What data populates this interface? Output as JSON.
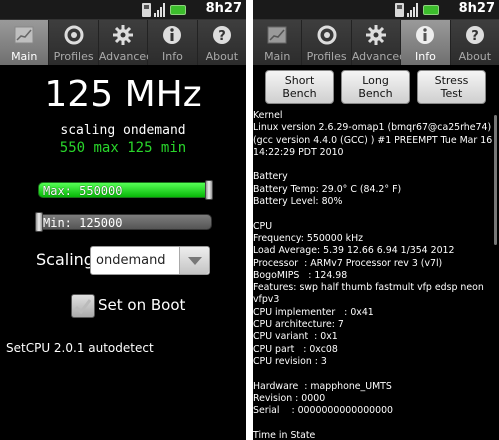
{
  "status": {
    "time": "8h27"
  },
  "tabs": [
    {
      "label": "Main",
      "icon": "chart-icon"
    },
    {
      "label": "Profiles",
      "icon": "dial-icon"
    },
    {
      "label": "Advanced",
      "icon": "gear-icon"
    },
    {
      "label": "Info",
      "icon": "info-icon"
    },
    {
      "label": "About",
      "icon": "question-icon"
    }
  ],
  "left": {
    "active_tab": "Main",
    "frequency": "125 MHz",
    "governor_line": "scaling ondemand",
    "maxmin_line": "550 max 125 min",
    "max_slider": {
      "label": "Max: 550000",
      "fraction": 1.0
    },
    "min_slider": {
      "label": "Min: 125000",
      "fraction": 0.0
    },
    "scaling_label": "Scaling",
    "scaling_value": "ondemand",
    "set_on_boot_label": "Set on Boot",
    "set_on_boot_checked": true,
    "footer": "SetCPU 2.0.1 autodetect"
  },
  "right": {
    "active_tab": "Info",
    "buttons": [
      {
        "label": "Short\nBench"
      },
      {
        "label": "Long\nBench"
      },
      {
        "label": "Stress\nTest"
      }
    ],
    "info_text": "Kernel\nLinux version 2.6.29-omap1 (bmqr67@ca25rhe74) (gcc version 4.4.0 (GCC) ) #1 PREEMPT Tue Mar 16 14:22:29 PDT 2010\n\nBattery\nBattery Temp: 29.0° C (84.2° F)\nBattery Level: 80%\n\nCPU\nFrequency: 550000 kHz\nLoad Average: 5.39 12.66 6.94 1/354 2012\nProcessor  : ARMv7 Processor rev 3 (v7l)\nBogoMIPS   : 124.98\nFeatures: swp half thumb fastmult vfp edsp neon vfpv3\nCPU implementer   : 0x41\nCPU architecture: 7\nCPU variant  : 0x1\nCPU part   : 0xc08\nCPU revision : 3\n\nHardware  : mapphone_UMTS\nRevision : 0000\nSerial    : 0000000000000000\n\nTime in State"
  },
  "colors": {
    "accent_green": "#29d62b",
    "background": "#000000"
  }
}
